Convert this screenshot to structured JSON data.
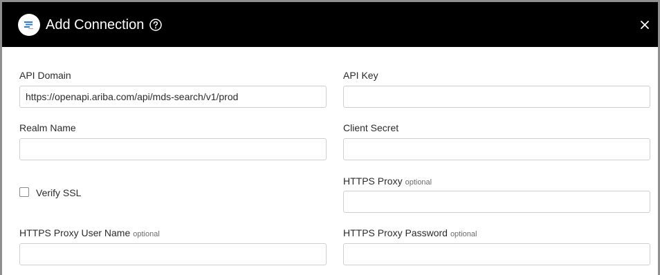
{
  "header": {
    "title": "Add Connection",
    "help_icon": "question-circle-icon",
    "close_icon": "close-icon",
    "logo_icon": "ariba-logo-icon"
  },
  "form": {
    "api_domain": {
      "label": "API Domain",
      "value": "https://openapi.ariba.com/api/mds-search/v1/prod"
    },
    "api_key": {
      "label": "API Key",
      "value": ""
    },
    "realm_name": {
      "label": "Realm Name",
      "value": ""
    },
    "client_secret": {
      "label": "Client Secret",
      "value": ""
    },
    "verify_ssl": {
      "label": "Verify SSL",
      "checked": false
    },
    "https_proxy": {
      "label": "HTTPS Proxy",
      "optional": "optional",
      "value": ""
    },
    "https_proxy_user": {
      "label": "HTTPS Proxy User Name",
      "optional": "optional",
      "value": ""
    },
    "https_proxy_password": {
      "label": "HTTPS Proxy Password",
      "optional": "optional",
      "value": ""
    }
  }
}
